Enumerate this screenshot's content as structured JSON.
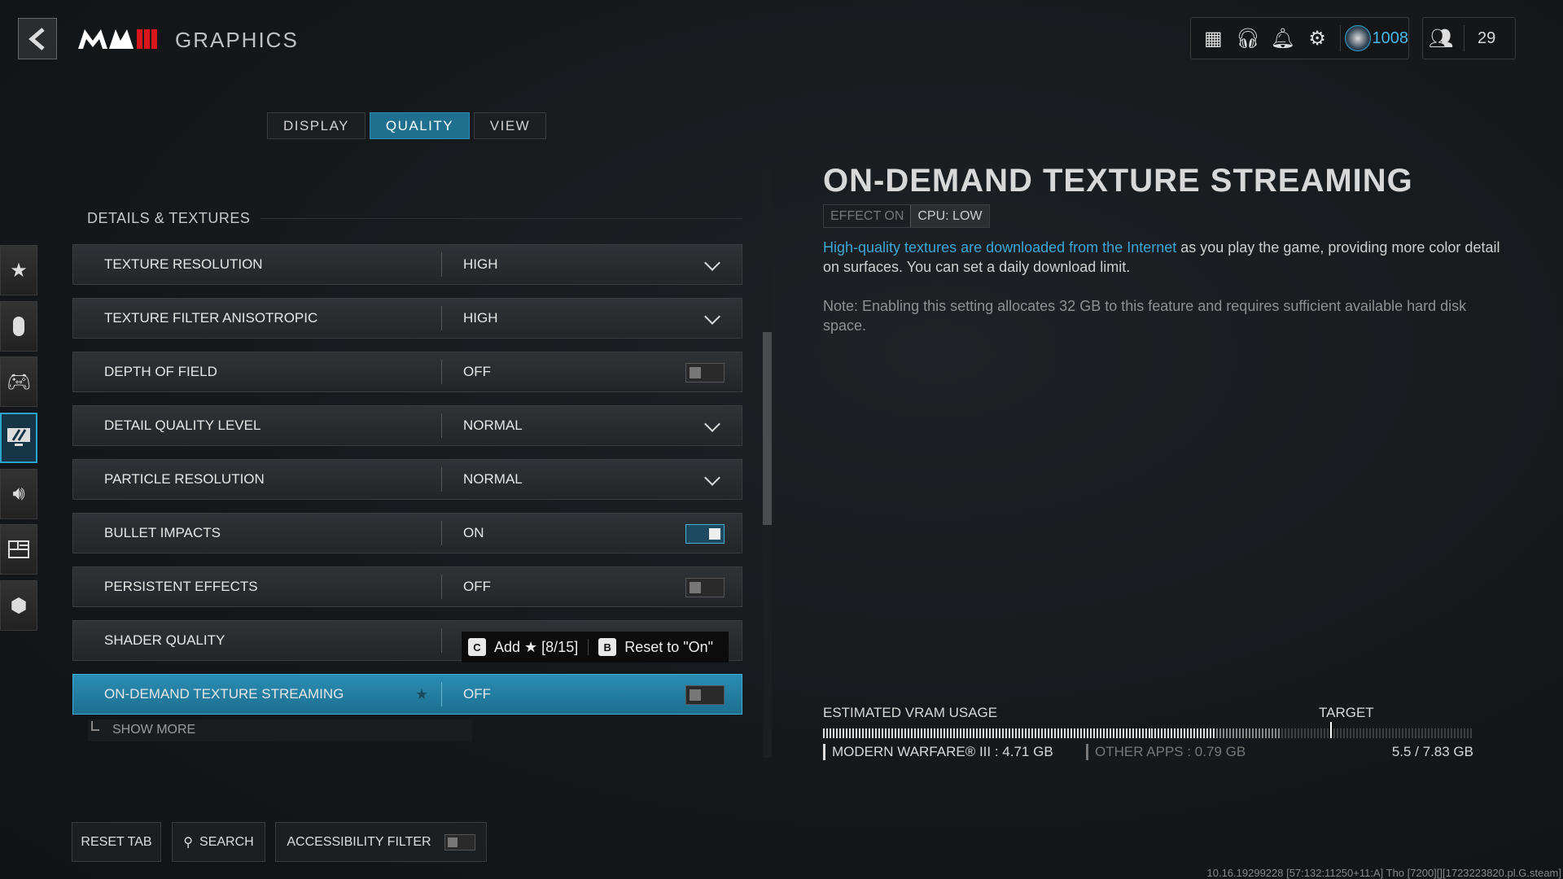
{
  "header": {
    "logo": "MWIII",
    "title": "GRAPHICS",
    "cod_points": "1008",
    "friends_count": "29",
    "accent": "#2ba3cf"
  },
  "tabs": [
    {
      "label": "DISPLAY"
    },
    {
      "label": "QUALITY",
      "active": true
    },
    {
      "label": "VIEW"
    }
  ],
  "sidebar": [
    "favorites",
    "mouse-keyboard",
    "controller",
    "graphics",
    "audio",
    "interface",
    "network"
  ],
  "section": "DETAILS & TEXTURES",
  "rows": [
    {
      "label": "TEXTURE RESOLUTION",
      "value": "HIGH",
      "type": "dropdown"
    },
    {
      "label": "TEXTURE FILTER ANISOTROPIC",
      "value": "HIGH",
      "type": "dropdown"
    },
    {
      "label": "DEPTH OF FIELD",
      "value": "OFF",
      "type": "toggle"
    },
    {
      "label": "DETAIL QUALITY LEVEL",
      "value": "NORMAL",
      "type": "dropdown"
    },
    {
      "label": "PARTICLE RESOLUTION",
      "value": "NORMAL",
      "type": "dropdown"
    },
    {
      "label": "BULLET IMPACTS",
      "value": "ON",
      "type": "toggle"
    },
    {
      "label": "PERSISTENT EFFECTS",
      "value": "OFF",
      "type": "toggle"
    },
    {
      "label": "SHADER QUALITY",
      "value": "",
      "type": "dropdown"
    },
    {
      "label": "ON-DEMAND TEXTURE STREAMING",
      "value": "OFF",
      "type": "toggle",
      "selected": true
    }
  ],
  "show_more": "SHOW MORE",
  "tooltip": {
    "key1": "C",
    "action1": "Add ★ [8/15]",
    "key2": "B",
    "action2": "Reset to \"On\""
  },
  "detail": {
    "title": "ON-DEMAND TEXTURE STREAMING",
    "badge1": "EFFECT ON",
    "badge2": "CPU: LOW",
    "desc_link": "High-quality textures are downloaded from the Internet",
    "desc_rest": " as you play the game, providing more color detail on surfaces. You can set a daily download limit.",
    "note": "Note: Enabling this setting allocates 32 GB to this feature and requires sufficient available hard disk space."
  },
  "vram": {
    "label": "ESTIMATED VRAM USAGE",
    "target_label": "TARGET",
    "game": "MODERN WARFARE® III : 4.71 GB",
    "other": "OTHER APPS : 0.79 GB",
    "total": "5.5 / 7.83 GB",
    "game_gb": 4.71,
    "other_gb": 0.79,
    "max_gb": 7.83,
    "target_fraction": 0.78
  },
  "bottom": {
    "reset": "RESET TAB",
    "search": "SEARCH",
    "accessibility": "ACCESSIBILITY FILTER"
  },
  "build": "10.16.19299228 [57:132:11250+11:A] Tho [7200][][1723223820.pl.G.steam]"
}
